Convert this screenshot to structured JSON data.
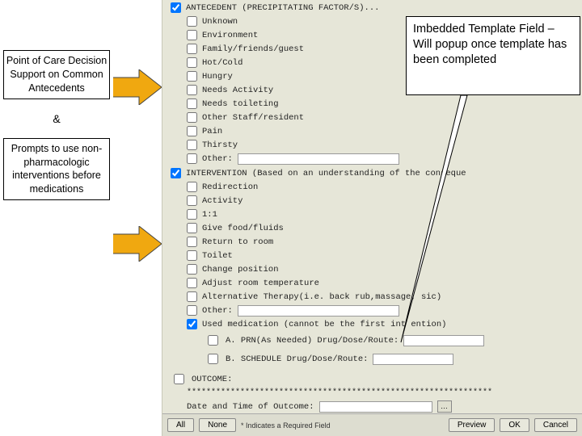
{
  "left": {
    "box1": "Point of Care Decision Support on Common Antecedents",
    "amp": "&",
    "box2": "Prompts to use non-pharmacologic interventions before medications"
  },
  "callout": "Imbedded Template Field – Will popup once template has been completed",
  "form": {
    "antecedent": {
      "title": "ANTECEDENT (PRECIPITATING FACTOR/S)...",
      "items": [
        "Unknown",
        "Environment",
        "Family/friends/guest",
        "Hot/Cold",
        "Hungry",
        "Needs Activity",
        "Needs toileting",
        "Other Staff/resident",
        "Pain",
        "Thirsty"
      ],
      "other_label": "Other:"
    },
    "intervention": {
      "title": "INTERVENTION (Based on an understanding of the conseque",
      "items": [
        "Redirection",
        "Activity",
        "1:1",
        "Give food/fluids",
        "Return to room",
        "Toilet",
        "Change position",
        "Adjust room temperature",
        "Alternative Therapy(i.e. back rub,massage,   sic)"
      ],
      "other_label": "Other:",
      "used_med": "Used medication (cannot be the first int   ention)",
      "sub_a": "A. PRN(As Needed) Drug/Dose/Route:",
      "sub_b": "B. SCHEDULE        Drug/Dose/Route:"
    },
    "outcome": {
      "label": "OUTCOME:",
      "stars": "***************************************************************",
      "dt_label": "Date and Time of Outcome:"
    },
    "buttons": {
      "all": "All",
      "none": "None",
      "req": "* Indicates a Required Field",
      "preview": "Preview",
      "ok": "OK",
      "cancel": "Cancel"
    }
  },
  "colors": {
    "arrow": "#f0a810",
    "arrow_border": "#444"
  }
}
